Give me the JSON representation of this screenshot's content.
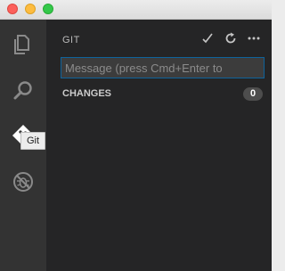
{
  "window": {
    "traffic_lights": [
      "close",
      "minimize",
      "maximize"
    ]
  },
  "activity_bar": {
    "items": [
      {
        "icon": "files-icon",
        "label": "Explorer"
      },
      {
        "icon": "search-icon",
        "label": "Search"
      },
      {
        "icon": "git-icon",
        "label": "Git",
        "active": true
      },
      {
        "icon": "debug-icon",
        "label": "Debug"
      }
    ],
    "tooltip": "Git"
  },
  "scm": {
    "title": "GIT",
    "actions": [
      "commit-icon",
      "refresh-icon",
      "more-icon"
    ],
    "message_placeholder": "Message (press Cmd+Enter to",
    "message_value": "",
    "changes_label": "CHANGES",
    "changes_count": "0"
  },
  "colors": {
    "activity_bar_bg": "#333333",
    "sidebar_bg": "#252526",
    "input_border_focus": "#0e639c"
  }
}
